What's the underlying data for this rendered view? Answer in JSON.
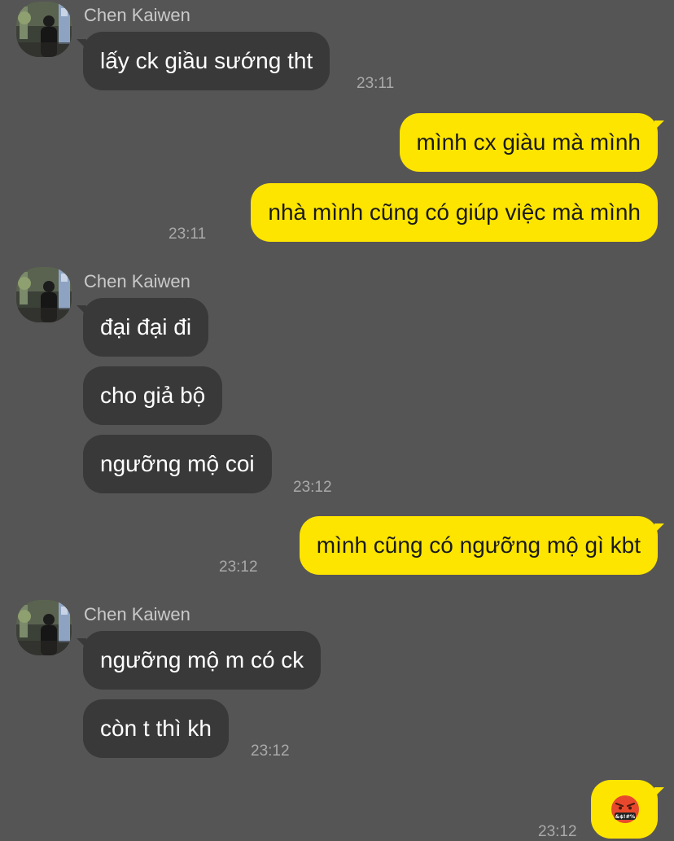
{
  "colors": {
    "background": "#565556",
    "incoming_bubble": "#3a393a",
    "outgoing_bubble": "#fee500"
  },
  "groups": [
    {
      "sender": "Chen Kaiwen",
      "avatar_icon": "profile-photo",
      "messages": [
        {
          "text": "lấy ck giầu sướng tht",
          "time": "23:11"
        }
      ]
    },
    {
      "sender": "Chen Kaiwen",
      "avatar_icon": "profile-photo",
      "messages": [
        {
          "text": "đại đại đi"
        },
        {
          "text": "cho giả bộ"
        },
        {
          "text": "ngưỡng mộ coi",
          "time": "23:12"
        }
      ]
    },
    {
      "sender": "Chen Kaiwen",
      "avatar_icon": "profile-photo",
      "messages": [
        {
          "text": "ngưỡng mộ m có ck"
        },
        {
          "text": "còn t thì kh",
          "time": "23:12"
        }
      ]
    }
  ],
  "outgoing": [
    {
      "text": "mình cx giàu mà mình"
    },
    {
      "text": "nhà mình cũng có giúp việc mà mình",
      "time": "23:11"
    },
    {
      "text": "mình cũng có ngưỡng mộ gì kbt",
      "time": "23:12"
    },
    {
      "emoji": "angry-swearing-face-emoji",
      "emoji_text": "&$!#%",
      "time": "23:12"
    }
  ]
}
